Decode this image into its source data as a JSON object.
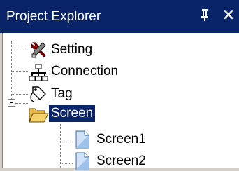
{
  "panel": {
    "title": "Project Explorer",
    "pin_glyph": "\u0004",
    "close_glyph": "✕"
  },
  "tree": {
    "nodes": [
      {
        "label": "Setting",
        "icon": "tools-icon"
      },
      {
        "label": "Connection",
        "icon": "network-icon"
      },
      {
        "label": "Tag",
        "icon": "tag-icon"
      },
      {
        "label": "Screen",
        "icon": "folder-open-icon",
        "expanded": true,
        "selected": true
      },
      {
        "label": "Screen1",
        "icon": "document-icon"
      },
      {
        "label": "Screen2",
        "icon": "document-icon"
      }
    ]
  },
  "colors": {
    "title_bar": "#0a246a",
    "selection": "#0a246a",
    "panel_bg": "#d4d0c8"
  }
}
